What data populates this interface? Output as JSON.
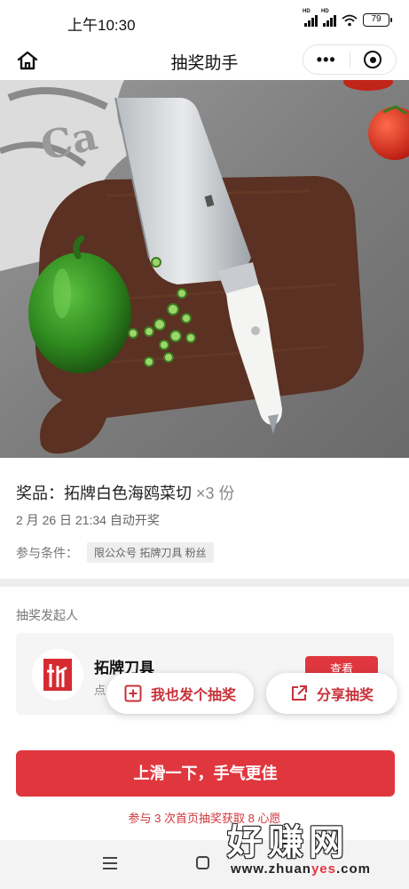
{
  "status_bar": {
    "time": "上午10:30",
    "hd1": "HD",
    "hd2": "HD",
    "battery": "79"
  },
  "nav": {
    "title": "抽奖助手",
    "more_label": "•••"
  },
  "prize": {
    "prefix": "奖品：",
    "name": "拓牌白色海鸥菜切",
    "quantity": "×3 份",
    "open_time": "2 月 26 日 21:34 自动开奖",
    "condition_label": "参与条件：",
    "condition_tag": "限公众号 拓牌刀具 粉丝"
  },
  "initiator": {
    "heading": "抽奖发起人",
    "name": "拓牌刀具",
    "sub": "点",
    "view_button": "查看"
  },
  "actions": {
    "create_lottery": "我也发个抽奖",
    "share_lottery": "分享抽奖"
  },
  "bottom": {
    "main_button": "上滑一下，手气更佳",
    "tip": "参与 3 次首页抽奖获取 8 心愿"
  },
  "watermark": {
    "big": "好赚网",
    "url_prefix": "www.zhuan",
    "url_mid": "yes",
    "url_suffix": ".com"
  },
  "colors": {
    "accent": "#e0373f",
    "board": "#5a3122",
    "pepper": "#2f8a1f",
    "background": "#ededed"
  },
  "icons": {
    "home": "home-icon",
    "more": "more-dots-icon",
    "close": "target-icon",
    "create": "plus-box-icon",
    "share": "share-icon",
    "menu": "menu-icon",
    "sys_home": "square-icon"
  }
}
